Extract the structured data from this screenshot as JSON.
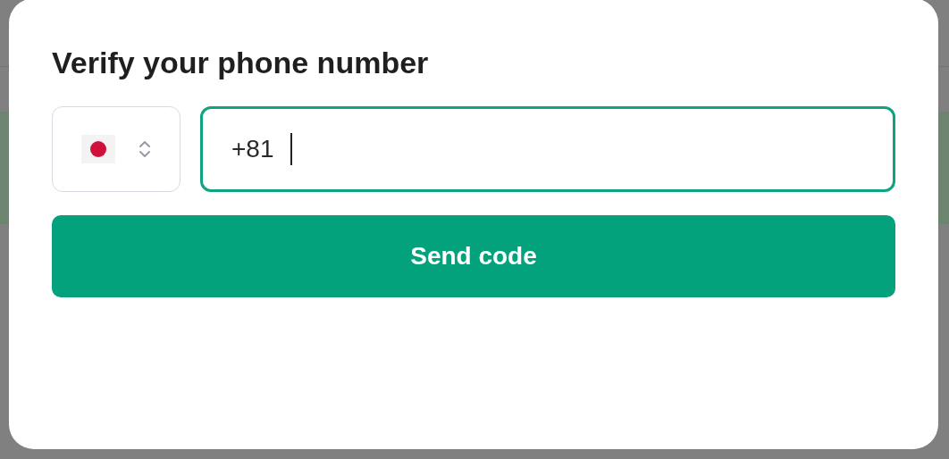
{
  "dialog": {
    "title": "Verify your phone number",
    "phone_field": {
      "value": "+81",
      "focused": true
    },
    "button": {
      "label": "Send code"
    }
  }
}
